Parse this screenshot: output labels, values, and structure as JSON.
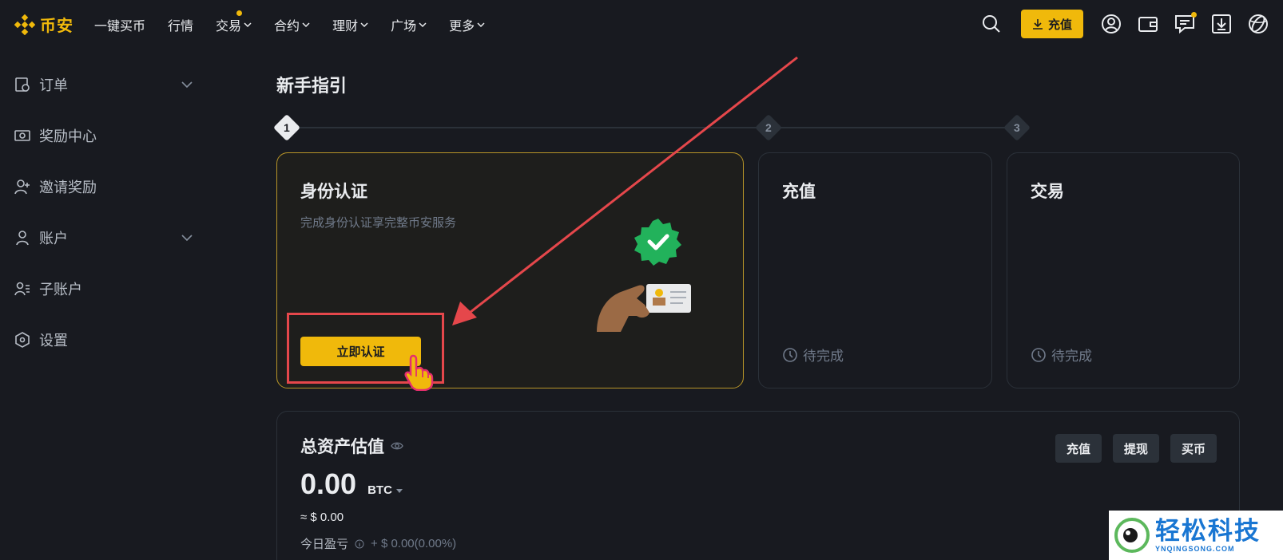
{
  "brand": {
    "name": "币安",
    "accent": "#f0b90b"
  },
  "topnav": {
    "items": [
      {
        "label": "一键买币",
        "dropdown": false,
        "dot": false
      },
      {
        "label": "行情",
        "dropdown": false,
        "dot": false
      },
      {
        "label": "交易",
        "dropdown": true,
        "dot": true
      },
      {
        "label": "合约",
        "dropdown": true,
        "dot": false
      },
      {
        "label": "理财",
        "dropdown": true,
        "dot": false
      },
      {
        "label": "广场",
        "dropdown": true,
        "dot": false
      },
      {
        "label": "更多",
        "dropdown": true,
        "dot": false
      }
    ],
    "deposit_label": "充值",
    "icons": [
      "search-icon",
      "user-icon",
      "wallet-icon",
      "message-icon",
      "download-icon",
      "globe-icon"
    ]
  },
  "sidebar": {
    "items": [
      {
        "label": "订单",
        "icon": "order-icon",
        "dropdown": true
      },
      {
        "label": "奖励中心",
        "icon": "reward-icon",
        "dropdown": false
      },
      {
        "label": "邀请奖励",
        "icon": "invite-icon",
        "dropdown": false
      },
      {
        "label": "账户",
        "icon": "account-icon",
        "dropdown": true
      },
      {
        "label": "子账户",
        "icon": "sub-account-icon",
        "dropdown": false
      },
      {
        "label": "设置",
        "icon": "settings-icon",
        "dropdown": false
      }
    ]
  },
  "guide": {
    "title": "新手指引",
    "steps": [
      "1",
      "2",
      "3"
    ],
    "active_step": 1,
    "identity": {
      "title": "身份认证",
      "subtitle": "完成身份认证享完整币安服务",
      "button": "立即认证"
    },
    "deposit": {
      "title": "充值",
      "status": "待完成"
    },
    "trade": {
      "title": "交易",
      "status": "待完成"
    }
  },
  "assets": {
    "title": "总资产估值",
    "value": "0.00",
    "unit": "BTC",
    "approx": "≈ $ 0.00",
    "pnl_label": "今日盈亏",
    "pnl_value": "+ $ 0.00(0.00%)",
    "buttons": [
      "充值",
      "提现",
      "买币"
    ]
  },
  "watermark": {
    "main": "轻松科技",
    "sub": "YNQINGSONG.COM"
  }
}
